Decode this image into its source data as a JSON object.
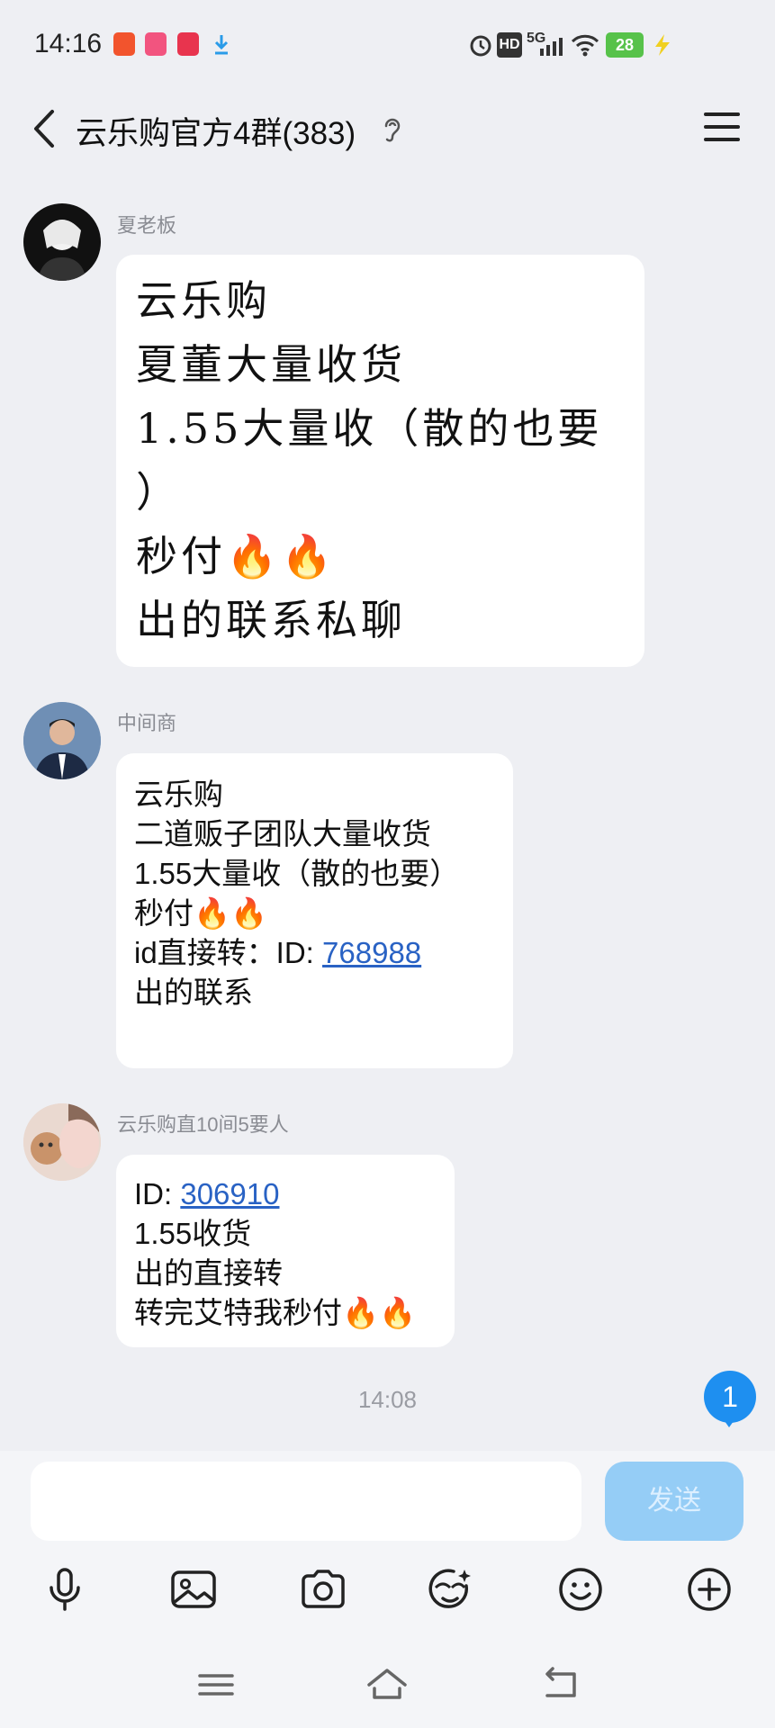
{
  "status_bar": {
    "time": "14:16",
    "signal": "5G",
    "battery": "28",
    "hd": "HD"
  },
  "header": {
    "title": "云乐购官方4群(383)"
  },
  "messages": [
    {
      "sender": "夏老板",
      "lines": [
        "云乐购",
        "夏董大量收货",
        "1.55大量收（散的也要",
        "）",
        "秒付🔥🔥",
        "出的联系私聊"
      ]
    },
    {
      "sender": "中间商",
      "lines": [
        "云乐购",
        "二道贩子团队大量收货",
        "1.55大量收（散的也要）",
        "秒付🔥🔥"
      ],
      "id_prefix": "id直接转：ID: ",
      "id_value": "768988",
      "last_line": "出的联系"
    },
    {
      "sender": "云乐购直10间5要人",
      "id_prefix": "ID: ",
      "id_value": "306910",
      "lines": [
        "1.55收货",
        "出的直接转",
        "转完艾特我秒付🔥🔥"
      ]
    }
  ],
  "timestamp": "14:08",
  "unread_count": "1",
  "input": {
    "placeholder": "",
    "send_label": "发送"
  },
  "toolbar_icons": [
    "microphone-icon",
    "image-icon",
    "camera-icon",
    "sticker-icon",
    "emoji-icon",
    "plus-icon"
  ],
  "colors": {
    "background": "#eeeff3",
    "link": "#2962c4",
    "send_button": "#95cdf6",
    "unread_badge": "#1e8ff0"
  }
}
